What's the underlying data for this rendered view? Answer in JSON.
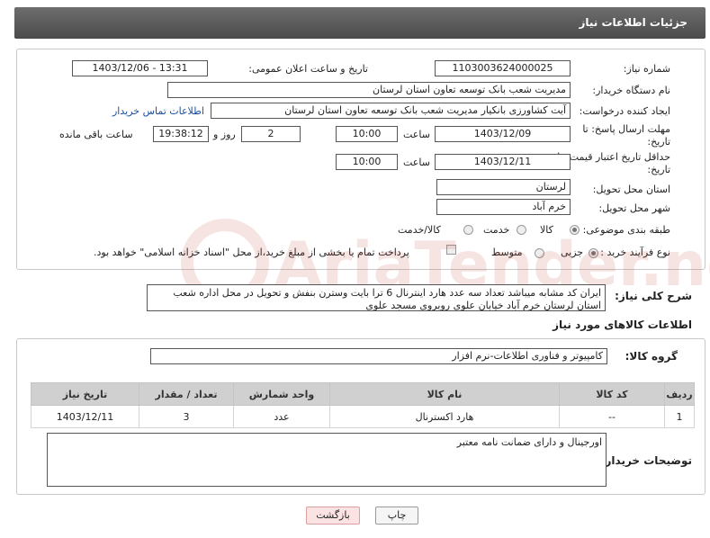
{
  "header": {
    "title": "جزئیات اطلاعات نیاز"
  },
  "form": {
    "need_number": {
      "label": "شماره نیاز:",
      "value": "1103003624000025"
    },
    "announce_datetime": {
      "label": "تاریخ و ساعت اعلان عمومی:",
      "value": "1403/12/06 - 13:31"
    },
    "buyer_org": {
      "label": "نام دستگاه خریدار:",
      "value": "مدیریت شعب بانک توسعه تعاون استان لرستان"
    },
    "requester": {
      "label": "ایجاد کننده درخواست:",
      "value": "آیت کشاورزی بانکیار مدیریت شعب بانک توسعه تعاون استان لرستان",
      "contact_link": "اطلاعات تماس خریدار"
    },
    "reply_deadline": {
      "label_line1": "مهلت ارسال پاسخ: تا",
      "label_line2": "تاریخ:",
      "date": "1403/12/09",
      "time_label": "ساعت",
      "time": "10:00",
      "days": "2",
      "days_label": "روز و",
      "remaining": "19:38:12",
      "remaining_label": "ساعت باقی مانده"
    },
    "price_validity": {
      "label_line1": "حداقل تاریخ اعتبار قیمت: تا",
      "label_line2": "تاریخ:",
      "date": "1403/12/11",
      "time_label": "ساعت",
      "time": "10:00"
    },
    "delivery_province": {
      "label": "استان محل تحویل:",
      "value": "لرستان"
    },
    "delivery_city": {
      "label": "شهر محل تحویل:",
      "value": "خرم آباد"
    },
    "category": {
      "label": "طبقه بندی موضوعی:",
      "options": [
        "کالا",
        "خدمت",
        "کالا/خدمت"
      ],
      "selected": 0
    },
    "purchase_type": {
      "label": "نوع فرآیند خرید :",
      "options": [
        "جزیی",
        "متوسط"
      ],
      "selected": 0,
      "checkbox_text": "پرداخت تمام یا بخشی از مبلغ خرید،از محل \"اسناد خزانه اسلامی\" خواهد بود."
    }
  },
  "description": {
    "label": "شرح کلی نیاز:",
    "text": "ایران کد مشابه میباشد تعداد سه عدد هارد اینترنال 6 ترا بایت وسترن بنفش و تحویل در محل اداره شعب استان لرستان خرم آباد خیابان علوی روبروی مسجد علوی"
  },
  "goods": {
    "section_title": "اطلاعات کالاهای مورد نیاز",
    "group_label": "گروه کالا:",
    "group_value": "کامپیوتر و فناوری اطلاعات-نرم افزار",
    "table": {
      "headers": [
        "ردیف",
        "کد کالا",
        "نام کالا",
        "واحد شمارش",
        "تعداد / مقدار",
        "تاریخ نیاز"
      ],
      "rows": [
        [
          "1",
          "--",
          "هارد اکسترنال",
          "عدد",
          "3",
          "1403/12/11"
        ]
      ]
    },
    "notes_label": "توضیحات خریدار:",
    "notes_text": "اورجینال و دارای ضمانت نامه معتبر"
  },
  "actions": {
    "print": "چاپ",
    "back": "بازگشت"
  },
  "watermark": {
    "text": "AriaTender.neT",
    "color": "#c0392b"
  }
}
